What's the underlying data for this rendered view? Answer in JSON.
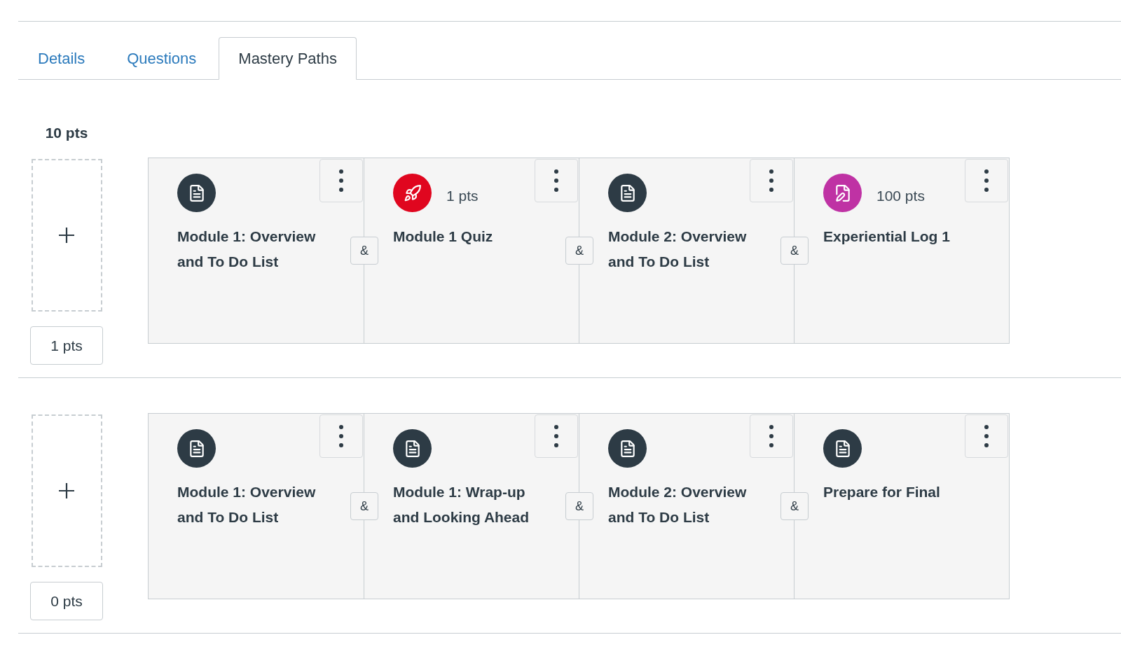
{
  "tabs": [
    {
      "label": "Details",
      "selected": false
    },
    {
      "label": "Questions",
      "selected": false
    },
    {
      "label": "Mastery Paths",
      "selected": true
    }
  ],
  "score_ranges": [
    {
      "upper_score": "10 pts",
      "lower_score": "1 pts",
      "assignments": [
        {
          "kind": "page",
          "title": "Module 1: Overview and To Do List",
          "connector": "&"
        },
        {
          "kind": "quiz",
          "points": "1 pts",
          "title": "Module 1 Quiz",
          "connector": "&"
        },
        {
          "kind": "page",
          "title": "Module 2: Overview and To Do List",
          "connector": "&"
        },
        {
          "kind": "assignment",
          "points": "100 pts",
          "title": "Experiential Log 1"
        }
      ]
    },
    {
      "lower_score": "0 pts",
      "assignments": [
        {
          "kind": "page",
          "title": "Module 1: Overview and To Do List",
          "connector": "&"
        },
        {
          "kind": "page",
          "title": "Module 1: Wrap-up and Looking Ahead",
          "connector": "&"
        },
        {
          "kind": "page",
          "title": "Module 2: Overview and To Do List",
          "connector": "&"
        },
        {
          "kind": "page",
          "title": "Prepare for Final"
        }
      ]
    }
  ]
}
